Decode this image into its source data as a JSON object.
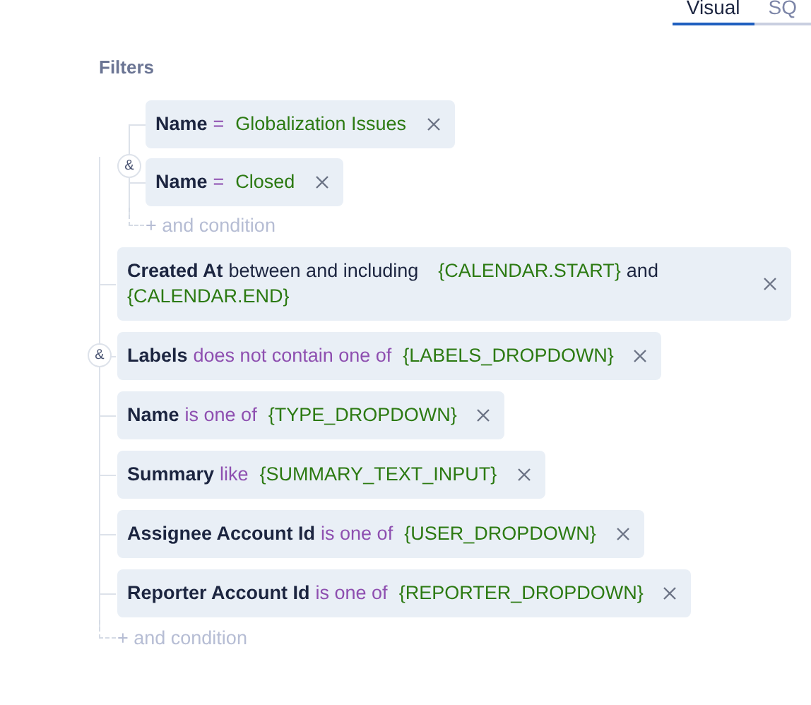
{
  "tabs": [
    {
      "label": "Visual",
      "selected": true
    },
    {
      "label": "SQ",
      "selected": false
    }
  ],
  "filters": {
    "title": "Filters",
    "conjunction": "&",
    "add_label": "+ and condition",
    "items": [
      {
        "kind": "group",
        "conjunction": "&",
        "add_label": "+ and condition",
        "items": [
          {
            "kind": "condition",
            "field": "Name",
            "operator_highlighted": true,
            "operator": "=",
            "values": [
              "Globalization Issues"
            ]
          },
          {
            "kind": "condition",
            "field": "Name",
            "operator_highlighted": true,
            "operator": "=",
            "values": [
              "Closed"
            ]
          }
        ]
      },
      {
        "kind": "condition",
        "field": "Created At",
        "operator_highlighted": false,
        "operator": "between and including",
        "values": [
          "{CALENDAR.START}",
          "{CALENDAR.END}"
        ],
        "joiner": "and"
      },
      {
        "kind": "condition",
        "field": "Labels",
        "operator_highlighted": true,
        "operator": "does not contain one of",
        "values": [
          "{LABELS_DROPDOWN}"
        ]
      },
      {
        "kind": "condition",
        "field": "Name",
        "operator_highlighted": true,
        "operator": "is one of",
        "values": [
          "{TYPE_DROPDOWN}"
        ]
      },
      {
        "kind": "condition",
        "field": "Summary",
        "operator_highlighted": true,
        "operator": "like",
        "values": [
          "{SUMMARY_TEXT_INPUT}"
        ]
      },
      {
        "kind": "condition",
        "field": "Assignee Account Id",
        "operator_highlighted": true,
        "operator": "is one of",
        "values": [
          "{USER_DROPDOWN}"
        ]
      },
      {
        "kind": "condition",
        "field": "Reporter Account Id",
        "operator_highlighted": true,
        "operator": "is one of",
        "values": [
          "{REPORTER_DROPDOWN}"
        ]
      }
    ]
  }
}
